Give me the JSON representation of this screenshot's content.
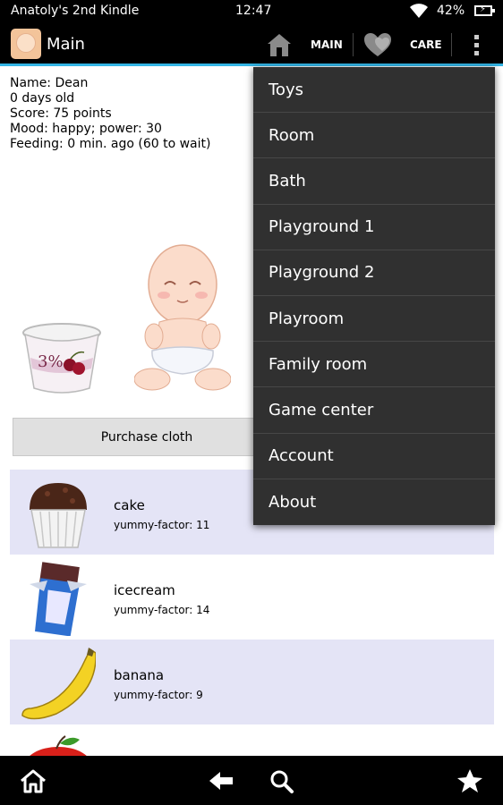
{
  "status_bar": {
    "device_name": "Anatoly's 2nd Kindle",
    "time": "12:47",
    "battery": "42%"
  },
  "action_bar": {
    "title": "Main",
    "main_label": "MAIN",
    "care_label": "CARE",
    "icons": [
      "app-icon",
      "house-icon",
      "hearts-icon",
      "overflow-menu-icon"
    ]
  },
  "info": {
    "name": "Name: Dean",
    "age": "0 days old",
    "score": "Score: 75 points",
    "mood": "Mood: happy; power: 30",
    "feeding": "Feeding: 0 min. ago (60 to wait)"
  },
  "purchase_button": "Purchase cloth",
  "food_items": [
    {
      "name": "cake",
      "yummy": "yummy-factor: 11",
      "icon": "muffin-icon"
    },
    {
      "name": "icecream",
      "yummy": "yummy-factor: 14",
      "icon": "icecream-bar-icon"
    },
    {
      "name": "banana",
      "yummy": "yummy-factor: 9",
      "icon": "banana-icon"
    },
    {
      "name": "",
      "yummy": "",
      "icon": "apple-icon"
    }
  ],
  "menu": [
    "Toys",
    "Room",
    "Bath",
    "Playground 1",
    "Playground 2",
    "Playroom",
    "Family room",
    "Game center",
    "Account",
    "About"
  ],
  "nav_icons": [
    "home-icon",
    "back-icon",
    "search-icon",
    "star-icon"
  ],
  "colors": {
    "accent": "#33b5e5",
    "menu_bg": "#303030",
    "row_alt": "#e4e4f6"
  }
}
